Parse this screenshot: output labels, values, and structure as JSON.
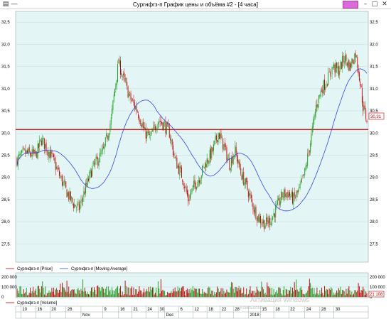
{
  "window": {
    "title": "Сургнфгз-п График цены и объёма #2 - [4 часа]",
    "left_icons": [
      "chart-icon",
      "collapse-icon"
    ],
    "buttons": [
      "minimize",
      "maximize",
      "close"
    ]
  },
  "colors": {
    "background": "#e4f5f6",
    "grid": "#c8dada",
    "up": "#1a9a1a",
    "down": "#c00000",
    "ma": "#3347d6",
    "hline": "#cc0000",
    "price_tag": "#c00000"
  },
  "legend": {
    "price": "Сургнфгз-п [Price]",
    "ma": "Сургнфгз-п [Moving Average]",
    "volume": "Сургнфгз-п [Volume]"
  },
  "price_tag": "30,31",
  "volume_tag": "21 108",
  "watermark": {
    "line1": "Активация Windows",
    "line2": "Компьютер..."
  },
  "chart_data": [
    {
      "type": "candlestick",
      "title": "",
      "ylim": [
        27.2,
        32.6
      ],
      "yticks": [
        27.5,
        28.0,
        28.5,
        29.0,
        29.5,
        30.0,
        30.5,
        31.0,
        31.5,
        32.0
      ],
      "ytick_labels": [
        "27,5",
        "28,0",
        "28,5",
        "29,0",
        "29,5",
        "30,0",
        "30,5",
        "31,0",
        "31,5",
        "32,0",
        "32,5"
      ],
      "horizontal_line": 30.08,
      "anchors": [
        [
          0,
          29.4
        ],
        [
          8,
          29.55
        ],
        [
          20,
          29.5
        ],
        [
          26,
          29.85
        ],
        [
          36,
          29.5
        ],
        [
          44,
          29.1
        ],
        [
          52,
          28.7
        ],
        [
          60,
          28.4
        ],
        [
          66,
          28.3
        ],
        [
          72,
          28.7
        ],
        [
          80,
          29.2
        ],
        [
          92,
          29.6
        ],
        [
          100,
          30.3
        ],
        [
          104,
          31.0
        ],
        [
          108,
          31.6
        ],
        [
          112,
          31.3
        ],
        [
          120,
          30.8
        ],
        [
          128,
          30.5
        ],
        [
          136,
          30.0
        ],
        [
          142,
          29.9
        ],
        [
          150,
          30.3
        ],
        [
          156,
          30.2
        ],
        [
          162,
          30.0
        ],
        [
          168,
          29.4
        ],
        [
          176,
          29.0
        ],
        [
          182,
          28.5
        ],
        [
          188,
          28.8
        ],
        [
          194,
          29.0
        ],
        [
          200,
          29.3
        ],
        [
          208,
          29.6
        ],
        [
          214,
          30.0
        ],
        [
          220,
          29.7
        ],
        [
          226,
          29.3
        ],
        [
          232,
          29.6
        ],
        [
          238,
          29.1
        ],
        [
          244,
          28.8
        ],
        [
          250,
          28.4
        ],
        [
          256,
          28.1
        ],
        [
          264,
          27.95
        ],
        [
          270,
          28.05
        ],
        [
          276,
          28.3
        ],
        [
          282,
          28.6
        ],
        [
          288,
          28.65
        ],
        [
          294,
          28.5
        ],
        [
          300,
          28.7
        ],
        [
          306,
          29.1
        ],
        [
          312,
          29.8
        ],
        [
          318,
          30.6
        ],
        [
          324,
          31.0
        ],
        [
          330,
          31.2
        ],
        [
          336,
          31.5
        ],
        [
          342,
          31.4
        ],
        [
          348,
          31.7
        ],
        [
          354,
          31.5
        ],
        [
          360,
          31.8
        ],
        [
          364,
          31.3
        ],
        [
          368,
          30.6
        ],
        [
          372,
          30.3
        ]
      ],
      "n_candles": 373,
      "ma_period": 40,
      "x_ticks": [
        {
          "label": "10",
          "i": 4
        },
        {
          "label": "16",
          "i": 20
        },
        {
          "label": "20",
          "i": 35
        },
        {
          "label": "26",
          "i": 52
        },
        {
          "label": "Nov",
          "i": 68
        },
        {
          "label": "9",
          "i": 91
        },
        {
          "label": "16",
          "i": 108
        },
        {
          "label": "21",
          "i": 122
        },
        {
          "label": "24",
          "i": 137
        },
        {
          "label": "30",
          "i": 150
        },
        {
          "label": "Dec",
          "i": 157
        },
        {
          "label": "6",
          "i": 172
        },
        {
          "label": "12",
          "i": 187
        },
        {
          "label": "18",
          "i": 202
        },
        {
          "label": "22",
          "i": 216
        },
        {
          "label": "28",
          "i": 230
        },
        {
          "label": "2018",
          "i": 246
        },
        {
          "label": "15",
          "i": 259
        },
        {
          "label": "18",
          "i": 273
        },
        {
          "label": "22",
          "i": 289
        },
        {
          "label": "24",
          "i": 306
        },
        {
          "label": "28",
          "i": 322
        },
        {
          "label": "30",
          "i": 337
        }
      ],
      "month_labels": [
        {
          "label": "Nov",
          "i": 68
        },
        {
          "label": "Dec",
          "i": 157
        },
        {
          "label": "2018",
          "i": 246
        }
      ]
    },
    {
      "type": "bar",
      "title": "",
      "ylim": [
        0,
        220000
      ],
      "ytick_labels": [
        "200 000",
        "100 000",
        "0"
      ],
      "yticks": [
        200000,
        100000,
        0
      ]
    }
  ]
}
